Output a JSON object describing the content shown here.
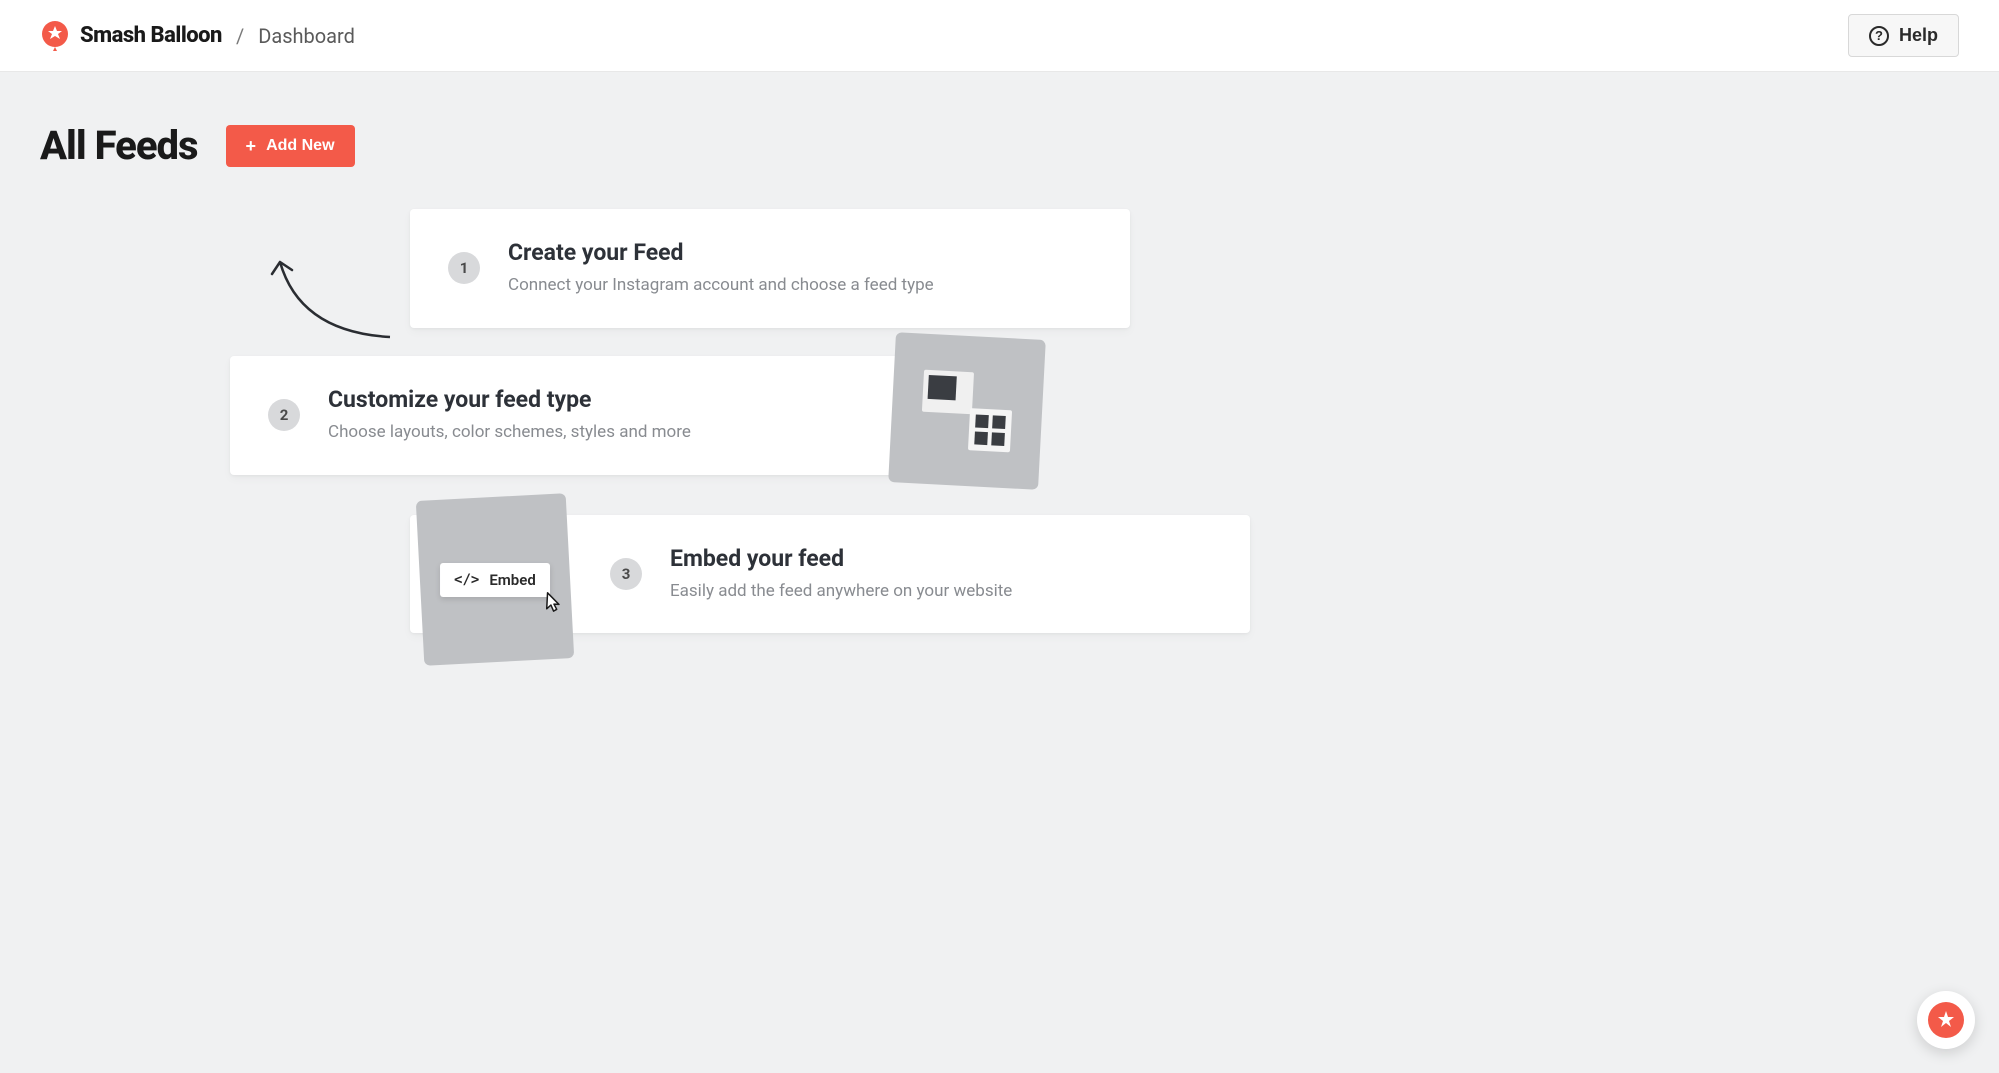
{
  "header": {
    "brand_name": "Smash Balloon",
    "breadcrumb_separator": "/",
    "breadcrumb_current": "Dashboard",
    "help_label": "Help"
  },
  "page": {
    "title": "All Feeds",
    "add_new_label": "Add New"
  },
  "steps": [
    {
      "number": "1",
      "title": "Create your Feed",
      "description": "Connect your Instagram account and choose a feed type"
    },
    {
      "number": "2",
      "title": "Customize your feed type",
      "description": "Choose layouts, color schemes, styles and more"
    },
    {
      "number": "3",
      "title": "Embed your feed",
      "description": "Easily add the feed anywhere on your website"
    }
  ],
  "embed_chip_label": "Embed"
}
